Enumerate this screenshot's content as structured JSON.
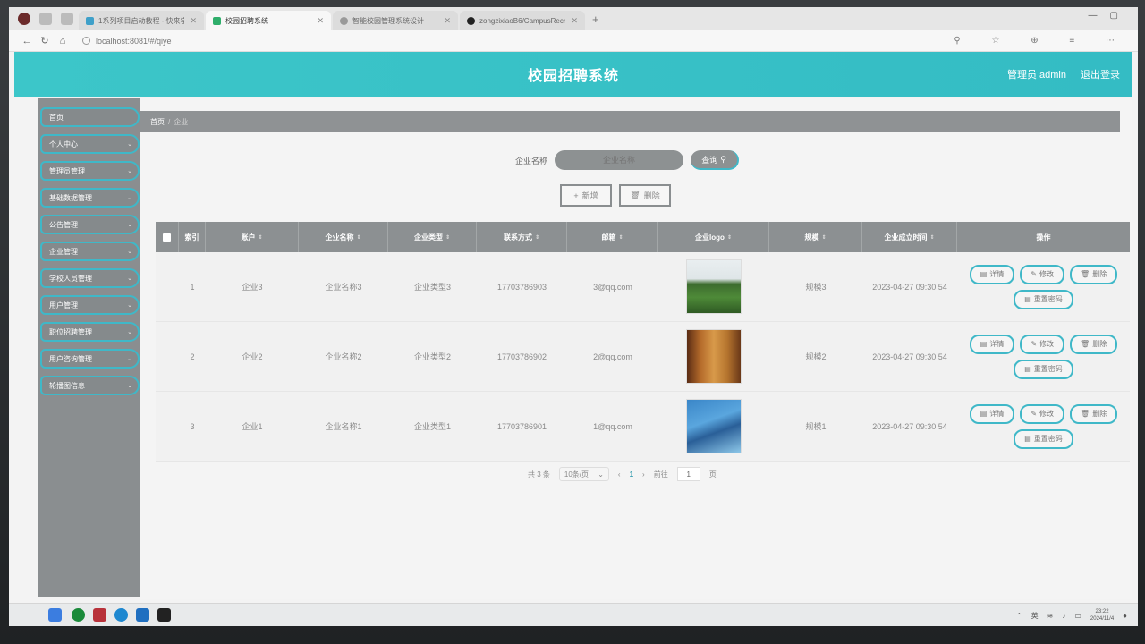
{
  "browser": {
    "tabs": [
      {
        "title": "1系列项目启动教程 - 快来学一学"
      },
      {
        "title": "校园招聘系统"
      },
      {
        "title": "智能校园管理系统设计"
      },
      {
        "title": "zongzixiaoB6/CampusRecruitm"
      }
    ],
    "url": "localhost:8081/#/qiye"
  },
  "header": {
    "title": "校园招聘系统",
    "user": "管理员 admin",
    "logout": "退出登录"
  },
  "sidebar": {
    "items": [
      {
        "label": "首页"
      },
      {
        "label": "个人中心"
      },
      {
        "label": "管理员管理"
      },
      {
        "label": "基础数据管理"
      },
      {
        "label": "公告管理"
      },
      {
        "label": "企业管理"
      },
      {
        "label": "学校人员管理"
      },
      {
        "label": "用户管理"
      },
      {
        "label": "职位招聘管理"
      },
      {
        "label": "用户咨询管理"
      },
      {
        "label": "轮播图信息"
      }
    ]
  },
  "breadcrumb": {
    "home": "首页",
    "current": "企业"
  },
  "search": {
    "label": "企业名称",
    "placeholder": "企业名称",
    "button": "查询"
  },
  "actions": {
    "add": "新增",
    "delete": "删除"
  },
  "table": {
    "headers": {
      "index": "索引",
      "account": "账户",
      "name": "企业名称",
      "type": "企业类型",
      "contact": "联系方式",
      "email": "邮箱",
      "logo": "企业logo",
      "scale": "规模",
      "founded": "企业成立时间",
      "ops": "操作"
    },
    "rows": [
      {
        "index": "1",
        "account": "企业3",
        "name": "企业名称3",
        "type": "企业类型3",
        "contact": "17703786903",
        "email": "3@qq.com",
        "scale": "规模3",
        "founded": "2023-04-27 09:30:54"
      },
      {
        "index": "2",
        "account": "企业2",
        "name": "企业名称2",
        "type": "企业类型2",
        "contact": "17703786902",
        "email": "2@qq.com",
        "scale": "规模2",
        "founded": "2023-04-27 09:30:54"
      },
      {
        "index": "3",
        "account": "企业1",
        "name": "企业名称1",
        "type": "企业类型1",
        "contact": "17703786901",
        "email": "1@qq.com",
        "scale": "规模1",
        "founded": "2023-04-27 09:30:54"
      }
    ],
    "ops": {
      "detail": "详情",
      "edit": "修改",
      "delete": "删除",
      "reset": "重置密码"
    }
  },
  "pagination": {
    "total": "共 3 条",
    "size": "10条/页",
    "current": "1",
    "goto": "前往",
    "page_input": "1",
    "page_unit": "页"
  },
  "taskbar": {
    "time": "23:22",
    "date": "2024/11/4"
  },
  "colors": {
    "accent": "#3fb8c8",
    "header": "#3cc6c9",
    "sidebar": "#8a8e90"
  }
}
